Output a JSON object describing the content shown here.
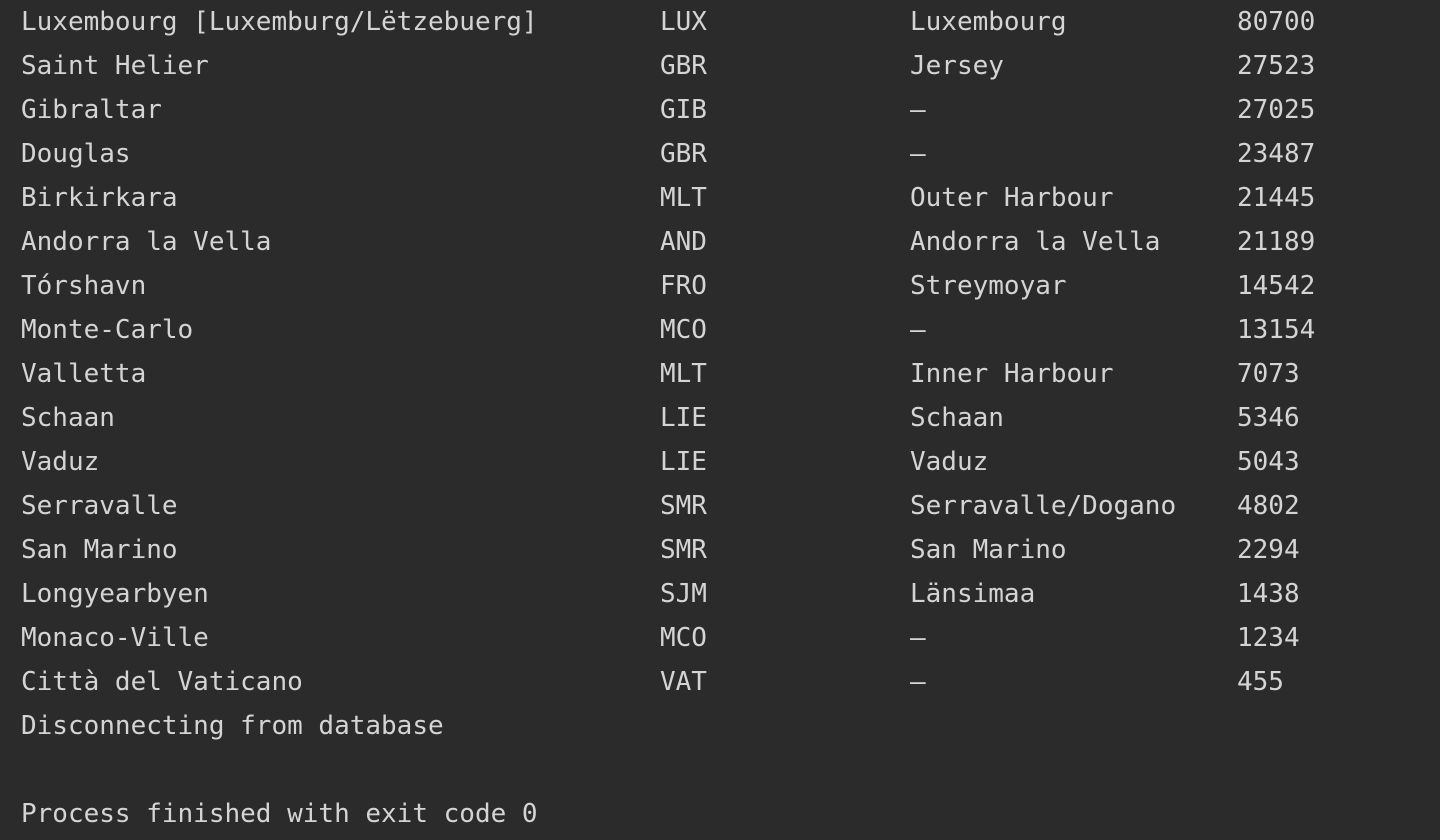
{
  "rows": [
    {
      "city": "Luxembourg [Luxemburg/Lëtzebuerg]",
      "code": "LUX",
      "district": "Luxembourg",
      "population": "80700"
    },
    {
      "city": "Saint Helier",
      "code": "GBR",
      "district": "Jersey",
      "population": "27523"
    },
    {
      "city": "Gibraltar",
      "code": "GIB",
      "district": "–",
      "population": "27025"
    },
    {
      "city": "Douglas",
      "code": "GBR",
      "district": "–",
      "population": "23487"
    },
    {
      "city": "Birkirkara",
      "code": "MLT",
      "district": "Outer Harbour",
      "population": "21445"
    },
    {
      "city": "Andorra la Vella",
      "code": "AND",
      "district": "Andorra la Vella",
      "population": "21189"
    },
    {
      "city": "Tórshavn",
      "code": "FRO",
      "district": "Streymoyar",
      "population": "14542"
    },
    {
      "city": "Monte-Carlo",
      "code": "MCO",
      "district": "–",
      "population": "13154"
    },
    {
      "city": "Valletta",
      "code": "MLT",
      "district": "Inner Harbour",
      "population": "7073"
    },
    {
      "city": "Schaan",
      "code": "LIE",
      "district": "Schaan",
      "population": "5346"
    },
    {
      "city": "Vaduz",
      "code": "LIE",
      "district": "Vaduz",
      "population": "5043"
    },
    {
      "city": "Serravalle",
      "code": "SMR",
      "district": "Serravalle/Dogano",
      "population": "4802"
    },
    {
      "city": "San Marino",
      "code": "SMR",
      "district": "San Marino",
      "population": "2294"
    },
    {
      "city": "Longyearbyen",
      "code": "SJM",
      "district": "Länsimaa",
      "population": "1438"
    },
    {
      "city": "Monaco-Ville",
      "code": "MCO",
      "district": "–",
      "population": "1234"
    },
    {
      "city": "Città del Vaticano",
      "code": "VAT",
      "district": "–",
      "population": "455"
    }
  ],
  "messages": {
    "disconnect": "Disconnecting from database",
    "finished": "Process finished with exit code 0"
  }
}
